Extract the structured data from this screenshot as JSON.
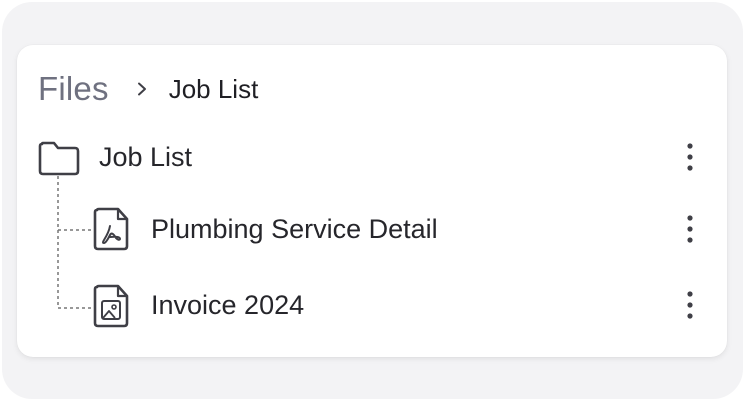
{
  "breadcrumb": {
    "root": "Files",
    "separator_icon": "chevron-right-icon",
    "current": "Job List"
  },
  "tree": {
    "folder": {
      "label": "Job List",
      "icon": "folder-icon",
      "menu_icon": "more-vertical-icon"
    },
    "files": [
      {
        "label": "Plumbing Service Detail",
        "icon": "pdf-file-icon",
        "menu_icon": "more-vertical-icon"
      },
      {
        "label": "Invoice 2024",
        "icon": "image-file-icon",
        "menu_icon": "more-vertical-icon"
      }
    ]
  },
  "colors": {
    "outer_background": "#f3f3f5",
    "card_background": "#ffffff",
    "root_text": "#6f7180",
    "text": "#26262b",
    "icon_stroke": "#3f3f46"
  }
}
